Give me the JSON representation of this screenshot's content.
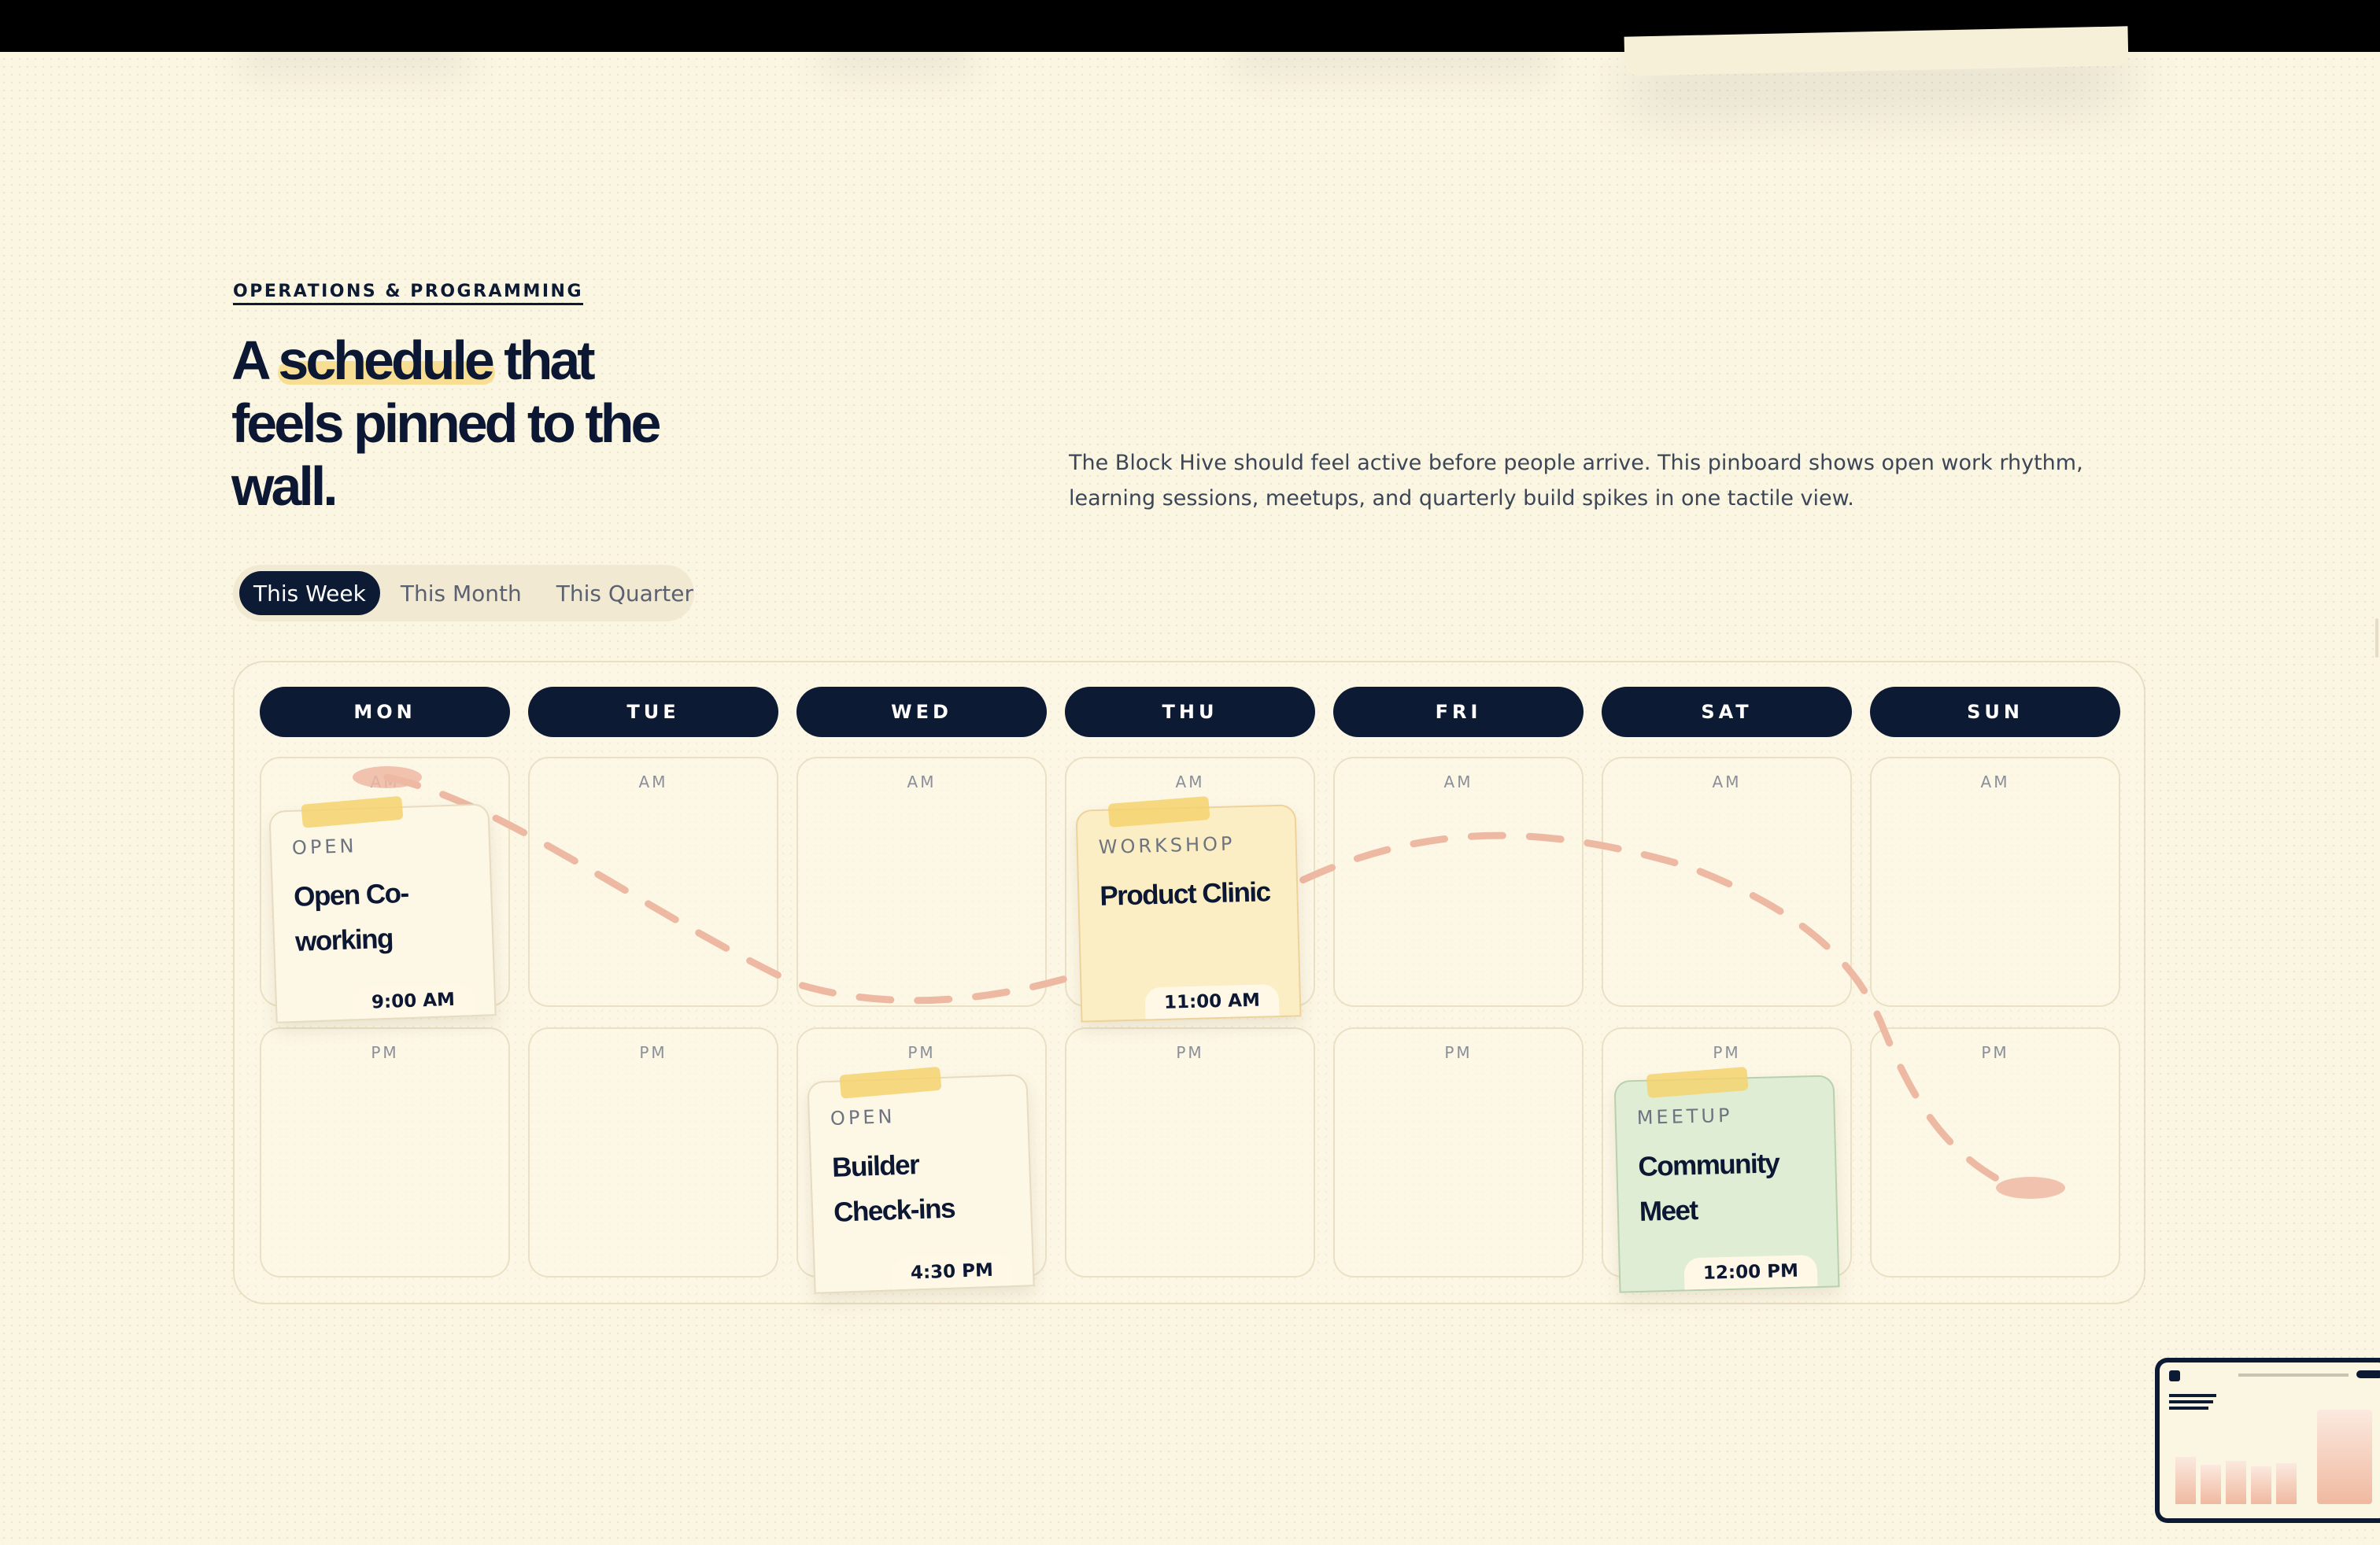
{
  "section": {
    "eyebrow": "OPERATIONS & PROGRAMMING",
    "headline": {
      "before": "A ",
      "highlight": "schedule",
      "after": " that feels pinned to the wall."
    },
    "description": "The Block Hive should feel active before people arrive. This pinboard shows open work rhythm, learning sessions, meetups, and quarterly build spikes in one tactile view."
  },
  "tabs": [
    {
      "label": "This Week",
      "active": true
    },
    {
      "label": "This Month",
      "active": false
    },
    {
      "label": "This Quarter",
      "active": false
    }
  ],
  "days": [
    "MON",
    "TUE",
    "WED",
    "THU",
    "FRI",
    "SAT",
    "SUN"
  ],
  "slot_labels": {
    "am": "AM",
    "pm": "PM"
  },
  "events": [
    {
      "category": "OPEN",
      "title": "Open Co-working",
      "time": "9:00 AM",
      "day": "MON",
      "period": "AM",
      "color": "#fdf7e6"
    },
    {
      "category": "WORKSHOP",
      "title": "Product Clinic",
      "time": "11:00 AM",
      "day": "THU",
      "period": "AM",
      "color": "#fbeec4"
    },
    {
      "category": "OPEN",
      "title": "Builder Check-ins",
      "time": "4:30 PM",
      "day": "WED",
      "period": "PM",
      "color": "#fdf7e6"
    },
    {
      "category": "MEETUP",
      "title": "Community Meet",
      "time": "12:00 PM",
      "day": "SAT",
      "period": "PM",
      "color": "#dfedd5"
    }
  ],
  "colors": {
    "navy": "#0d1a33",
    "background": "#fbf6e2",
    "highlight": "#f7dc8a",
    "tape": "#f5d26e",
    "path": "#eeb9a3"
  }
}
